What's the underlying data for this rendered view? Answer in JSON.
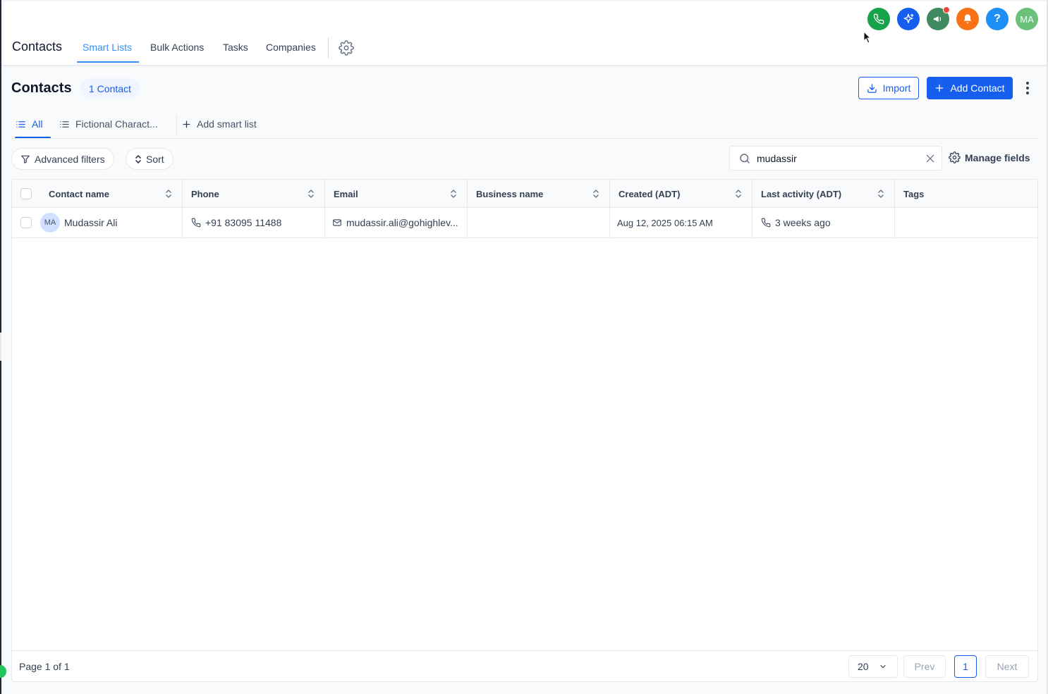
{
  "header": {
    "app_title": "Contacts",
    "tabs": [
      {
        "label": "Smart Lists",
        "active": true
      },
      {
        "label": "Bulk Actions",
        "active": false
      },
      {
        "label": "Tasks",
        "active": false
      },
      {
        "label": "Companies",
        "active": false
      }
    ],
    "top_icons": [
      {
        "name": "phone-icon",
        "color": "#16a34a"
      },
      {
        "name": "ai-sparkle-icon",
        "color": "#155eef"
      },
      {
        "name": "megaphone-icon",
        "color": "#3f8a5f"
      },
      {
        "name": "bell-icon",
        "color": "#f97316"
      },
      {
        "name": "help-icon",
        "color": "#1d8ff5",
        "glyph": "?"
      }
    ],
    "user_avatar_initials": "MA"
  },
  "page": {
    "title": "Contacts",
    "count_badge": "1 Contact",
    "import_label": "Import",
    "add_contact_label": "Add Contact"
  },
  "smart_lists": {
    "tabs": [
      {
        "label": "All",
        "active": true
      },
      {
        "label": "Fictional Charact...",
        "active": false
      }
    ],
    "add_label": "Add smart list"
  },
  "filters": {
    "advanced_label": "Advanced filters",
    "sort_label": "Sort",
    "search_value": "mudassir",
    "manage_fields_label": "Manage fields"
  },
  "table": {
    "columns": [
      "Contact name",
      "Phone",
      "Email",
      "Business name",
      "Created (ADT)",
      "Last activity (ADT)",
      "Tags"
    ],
    "rows": [
      {
        "initials": "MA",
        "name": "Mudassir Ali",
        "phone": "+91 83095 11488",
        "email": "mudassir.ali@gohighlev...",
        "business": "",
        "created": "Aug 12, 2025 06:15 AM",
        "last_activity": "3 weeks ago",
        "tags": ""
      }
    ]
  },
  "pagination": {
    "page_info": "Page 1 of 1",
    "per_page": "20",
    "prev_label": "Prev",
    "current_page": "1",
    "next_label": "Next"
  },
  "colors": {
    "primary": "#155eef",
    "tab_active": "#2e90fa"
  }
}
